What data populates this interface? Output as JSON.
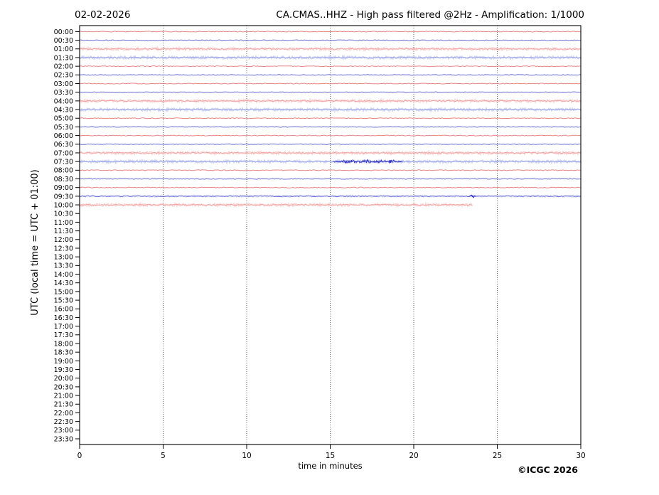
{
  "header": {
    "date": "02-02-2026",
    "title": "CA.CMAS..HHZ - High pass filtered @2Hz - Amplification: 1/1000"
  },
  "footer": {
    "copyright": "©ICGC 2026"
  },
  "axes": {
    "ylabel": "UTC (local time = UTC + 01:00)",
    "xlabel": "time in minutes",
    "x_ticks": [
      0,
      5,
      10,
      15,
      20,
      25,
      30
    ],
    "x_gridlines": [
      5,
      10,
      15,
      20,
      25
    ],
    "x_range": [
      0,
      30
    ],
    "y_rows_total": 48,
    "y_row_interval_minutes": 30
  },
  "chart_data": {
    "type": "line",
    "subtype": "helicorder-daily-drum-plot",
    "description": "24h seismogram, one 30-minute trace per row, traces recorded up to 10:00 UTC + 23.5 min; quiet flat traces with elevated background noise every 3 hours (01:00-01:30, 04:00-04:30, 07:00-07:30, 10:00) and a small seismic event burst on the 07:30 row between minutes ~15.2 and ~19.4",
    "colors": {
      "trace_red": "#e46a6a",
      "trace_blue": "#4a4ccc",
      "mid_red": "#ef9a9a",
      "mid_blue": "#929ae4",
      "halo_red": "#f7c6c6",
      "halo_blue": "#bcc4f2",
      "event_blue": "#2a2ac0",
      "grid": "#555555",
      "frame": "#000000"
    },
    "rows": [
      {
        "time": "00:00",
        "color": "red",
        "noise": "low",
        "extent": [
          0,
          30
        ]
      },
      {
        "time": "00:30",
        "color": "blue",
        "noise": "low",
        "extent": [
          0,
          30
        ]
      },
      {
        "time": "01:00",
        "color": "red",
        "noise": "high",
        "extent": [
          0,
          30
        ]
      },
      {
        "time": "01:30",
        "color": "blue",
        "noise": "high",
        "extent": [
          0,
          30
        ]
      },
      {
        "time": "02:00",
        "color": "red",
        "noise": "low",
        "extent": [
          0,
          30
        ]
      },
      {
        "time": "02:30",
        "color": "blue",
        "noise": "low",
        "extent": [
          0,
          30
        ]
      },
      {
        "time": "03:00",
        "color": "red",
        "noise": "low",
        "extent": [
          0,
          30
        ]
      },
      {
        "time": "03:30",
        "color": "blue",
        "noise": "low",
        "extent": [
          0,
          30
        ]
      },
      {
        "time": "04:00",
        "color": "red",
        "noise": "high",
        "extent": [
          0,
          30
        ]
      },
      {
        "time": "04:30",
        "color": "blue",
        "noise": "high",
        "extent": [
          0,
          30
        ]
      },
      {
        "time": "05:00",
        "color": "red",
        "noise": "low",
        "extent": [
          0,
          30
        ]
      },
      {
        "time": "05:30",
        "color": "blue",
        "noise": "low",
        "extent": [
          0,
          30
        ]
      },
      {
        "time": "06:00",
        "color": "red",
        "noise": "low",
        "extent": [
          0,
          30
        ]
      },
      {
        "time": "06:30",
        "color": "blue",
        "noise": "low",
        "extent": [
          0,
          30
        ]
      },
      {
        "time": "07:00",
        "color": "red",
        "noise": "high",
        "extent": [
          0,
          30
        ]
      },
      {
        "time": "07:30",
        "color": "blue",
        "noise": "high",
        "extent": [
          0,
          30
        ],
        "events": [
          {
            "start": 15.2,
            "end": 19.35,
            "bursts": [
              [
                15.8,
                17.4
              ],
              [
                17.7,
                18.3
              ],
              [
                18.5,
                18.9
              ]
            ]
          }
        ]
      },
      {
        "time": "08:00",
        "color": "red",
        "noise": "low",
        "extent": [
          0,
          30
        ]
      },
      {
        "time": "08:30",
        "color": "blue",
        "noise": "low",
        "extent": [
          0,
          30
        ]
      },
      {
        "time": "09:00",
        "color": "red",
        "noise": "low",
        "extent": [
          0,
          30
        ]
      },
      {
        "time": "09:30",
        "color": "blue",
        "noise": "medium",
        "extent": [
          0,
          30
        ],
        "events": [
          {
            "start": 23.3,
            "end": 23.7,
            "bursts": [
              [
                23.4,
                23.6
              ]
            ]
          }
        ]
      },
      {
        "time": "10:00",
        "color": "red",
        "noise": "high",
        "extent": [
          0,
          23.5
        ]
      },
      {
        "time": "10:30",
        "color": "blue",
        "noise": "none",
        "extent": null
      },
      {
        "time": "11:00",
        "color": "red",
        "noise": "none",
        "extent": null
      },
      {
        "time": "11:30",
        "color": "blue",
        "noise": "none",
        "extent": null
      },
      {
        "time": "12:00",
        "color": "red",
        "noise": "none",
        "extent": null
      },
      {
        "time": "12:30",
        "color": "blue",
        "noise": "none",
        "extent": null
      },
      {
        "time": "13:00",
        "color": "red",
        "noise": "none",
        "extent": null
      },
      {
        "time": "13:30",
        "color": "blue",
        "noise": "none",
        "extent": null
      },
      {
        "time": "14:00",
        "color": "red",
        "noise": "none",
        "extent": null
      },
      {
        "time": "14:30",
        "color": "blue",
        "noise": "none",
        "extent": null
      },
      {
        "time": "15:00",
        "color": "red",
        "noise": "none",
        "extent": null
      },
      {
        "time": "15:30",
        "color": "blue",
        "noise": "none",
        "extent": null
      },
      {
        "time": "16:00",
        "color": "red",
        "noise": "none",
        "extent": null
      },
      {
        "time": "16:30",
        "color": "blue",
        "noise": "none",
        "extent": null
      },
      {
        "time": "17:00",
        "color": "red",
        "noise": "none",
        "extent": null
      },
      {
        "time": "17:30",
        "color": "blue",
        "noise": "none",
        "extent": null
      },
      {
        "time": "18:00",
        "color": "red",
        "noise": "none",
        "extent": null
      },
      {
        "time": "18:30",
        "color": "blue",
        "noise": "none",
        "extent": null
      },
      {
        "time": "19:00",
        "color": "red",
        "noise": "none",
        "extent": null
      },
      {
        "time": "19:30",
        "color": "blue",
        "noise": "none",
        "extent": null
      },
      {
        "time": "20:00",
        "color": "red",
        "noise": "none",
        "extent": null
      },
      {
        "time": "20:30",
        "color": "blue",
        "noise": "none",
        "extent": null
      },
      {
        "time": "21:00",
        "color": "red",
        "noise": "none",
        "extent": null
      },
      {
        "time": "21:30",
        "color": "blue",
        "noise": "none",
        "extent": null
      },
      {
        "time": "22:00",
        "color": "red",
        "noise": "none",
        "extent": null
      },
      {
        "time": "22:30",
        "color": "blue",
        "noise": "none",
        "extent": null
      },
      {
        "time": "23:00",
        "color": "red",
        "noise": "none",
        "extent": null
      },
      {
        "time": "23:30",
        "color": "blue",
        "noise": "none",
        "extent": null
      }
    ]
  }
}
